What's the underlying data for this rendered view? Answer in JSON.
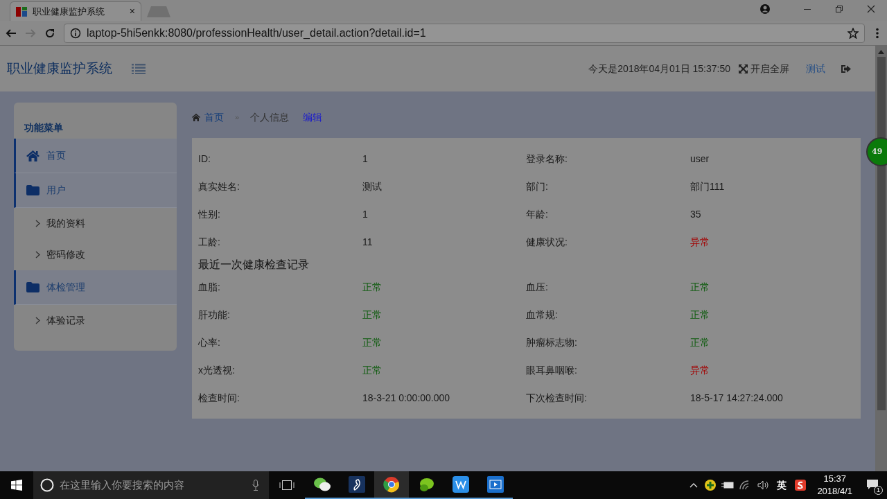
{
  "browser": {
    "tab_title": "职业健康监护系统",
    "tab_close": "×",
    "url": "laptop-5hi5enkk:8080/professionHealth/user_detail.action?detail.id=1"
  },
  "header": {
    "title": "职业健康监护系统",
    "datetime": "今天是2018年04月01日 15:37:50",
    "fullscreen": "开启全屏",
    "user": "测试"
  },
  "sidebar": {
    "heading": "功能菜单",
    "items": [
      {
        "label": "首页"
      },
      {
        "label": "用户",
        "expanded": true,
        "children": [
          {
            "label": "我的资料"
          },
          {
            "label": "密码修改"
          }
        ]
      },
      {
        "label": "体检管理",
        "expanded": true,
        "children": [
          {
            "label": "体验记录"
          }
        ]
      }
    ]
  },
  "breadcrumb": [
    {
      "kind": "home",
      "text": "首页"
    },
    {
      "kind": "separator",
      "text": "»"
    },
    {
      "kind": "current",
      "text": "个人信息"
    },
    {
      "kind": "action",
      "text": "编辑"
    }
  ],
  "info_rows": [
    [
      {
        "label": "ID:",
        "value": "1"
      },
      {
        "label": "登录名称:",
        "value": "user"
      }
    ],
    [
      {
        "label": "真实姓名:",
        "value": "测试"
      },
      {
        "label": "部门:",
        "value": "部门111"
      }
    ],
    [
      {
        "label": "性别:",
        "value": "1"
      },
      {
        "label": "年龄:",
        "value": "35"
      }
    ],
    [
      {
        "label": "工龄:",
        "value": "11"
      },
      {
        "label": "健康状况:",
        "value": "异常",
        "color": "#a30000"
      }
    ]
  ],
  "section_title": "最近一次健康检查记录",
  "check_rows": [
    [
      {
        "label": "血脂:",
        "value": "正常",
        "color": "#0a5a0a"
      },
      {
        "label": "血压:",
        "value": "正常",
        "color": "#0a5a0a"
      }
    ],
    [
      {
        "label": "肝功能:",
        "value": "正常",
        "color": "#0a5a0a"
      },
      {
        "label": "血常规:",
        "value": "正常",
        "color": "#0a5a0a"
      }
    ],
    [
      {
        "label": "心率:",
        "value": "正常",
        "color": "#0a5a0a"
      },
      {
        "label": "肿瘤标志物:",
        "value": "正常",
        "color": "#0a5a0a"
      }
    ],
    [
      {
        "label": "x光透视:",
        "value": "正常",
        "color": "#0a5a0a"
      },
      {
        "label": "眼耳鼻咽喉:",
        "value": "异常",
        "color": "#a30000"
      }
    ],
    [
      {
        "label": "检查时间:",
        "value": "18-3-21 0:00:00.000"
      },
      {
        "label": "下次检查时间:",
        "value": "18-5-17 14:27:24.000"
      }
    ]
  ],
  "float_badge": "49",
  "taskbar": {
    "search_placeholder": "在这里输入你要搜索的内容",
    "ime": "英",
    "time": "15:37",
    "date": "2018/4/1",
    "notifications": "1"
  }
}
